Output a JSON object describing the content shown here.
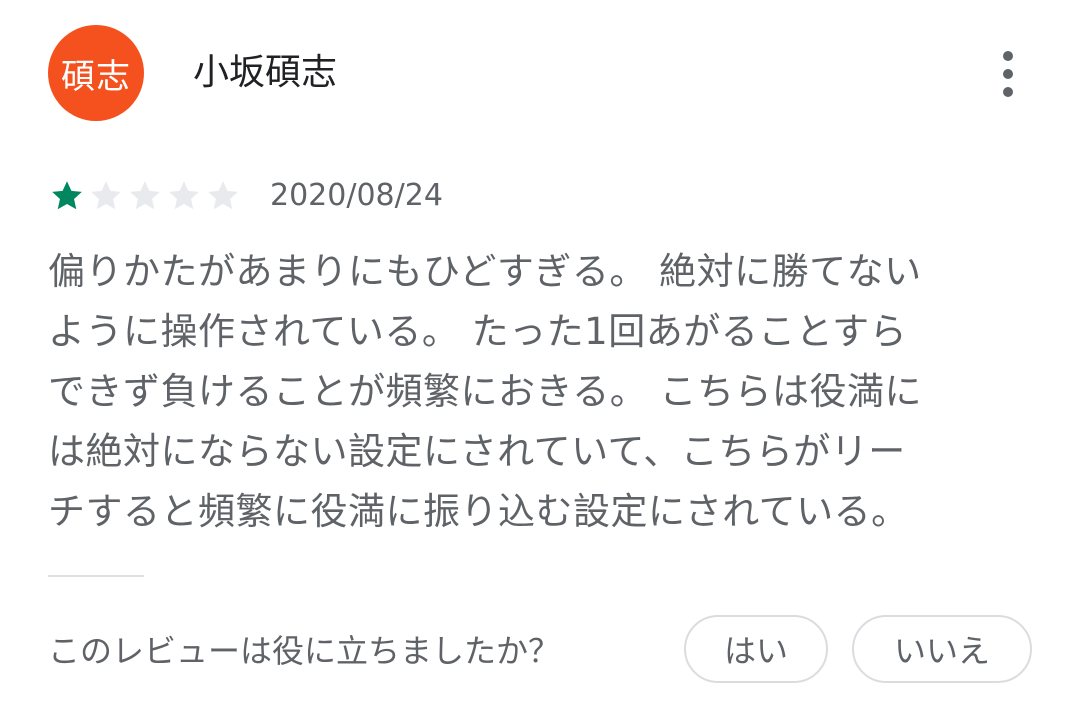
{
  "review": {
    "avatar_text": "碩志",
    "avatar_color": "#f4511e",
    "reviewer_name": "小坂碩志",
    "more_icon": "more-vert-icon",
    "rating": 1,
    "rating_max": 5,
    "star_filled_color": "#01875f",
    "star_empty_color": "#e8eaed",
    "date": "2020/08/24",
    "body": "偏りかたがあまりにもひどすぎる。 絶対に勝てない\nように操作されている。 たった1回あがることすら\nできず負けることが頻繁におきる。 こちらは役満に\nは絶対にならない設定にされていて、こちらがリー\nチすると頻繁に役満に振り込む設定にされている。"
  },
  "helpful": {
    "question": "このレビューは役に立ちましたか？",
    "yes_label": "はい",
    "no_label": "いいえ"
  }
}
